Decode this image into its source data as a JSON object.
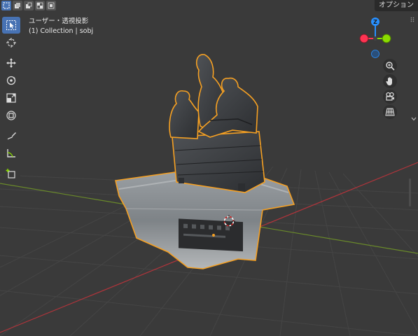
{
  "header": {
    "modes": [
      {
        "name": "select-box-mode",
        "active": true
      },
      {
        "name": "select-extend-mode",
        "active": false
      },
      {
        "name": "select-subtract-mode",
        "active": false
      },
      {
        "name": "select-invert-mode",
        "active": false
      },
      {
        "name": "select-intersect-mode",
        "active": false
      }
    ],
    "options_label": "オプション"
  },
  "viewport_info": {
    "view_name": "ユーザー・透視投影",
    "collection": "(1) Collection | sobj"
  },
  "toolbar": {
    "tools": [
      {
        "icon": "select-cursor-icon",
        "active": true
      },
      {
        "icon": "cursor-3d-icon",
        "active": false
      },
      {
        "icon": "move-icon",
        "active": false
      },
      {
        "icon": "rotate-icon",
        "active": false
      },
      {
        "icon": "scale-icon",
        "active": false
      },
      {
        "icon": "transform-icon",
        "active": false
      },
      {
        "icon": "annotate-icon",
        "active": false
      },
      {
        "icon": "measure-icon",
        "active": false
      },
      {
        "icon": "add-cube-icon",
        "active": false
      }
    ]
  },
  "gizmo": {
    "z_label": "Z",
    "colors": {
      "x": "#ff3352",
      "y": "#8bdc00",
      "z": "#2890ff"
    }
  },
  "nav_buttons": [
    {
      "icon": "zoom-icon"
    },
    {
      "icon": "hand-pan-icon"
    },
    {
      "icon": "camera-icon"
    },
    {
      "icon": "grid-ortho-icon"
    }
  ],
  "colors": {
    "background": "#3a3a3a",
    "selection_outline": "#f5a023",
    "active_blue": "#4772b3",
    "x_axis": "#b0343b",
    "y_axis": "#6a8a2a"
  }
}
